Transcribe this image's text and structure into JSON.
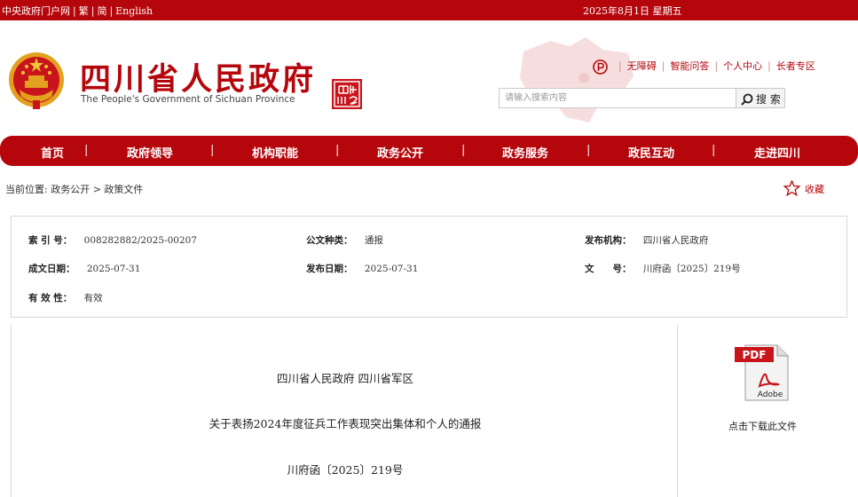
{
  "topbar": {
    "links": [
      "中央政府门户网",
      "繁",
      "简",
      "English"
    ],
    "separator": "|",
    "date": "2025年8月1日 星期五"
  },
  "header": {
    "title": "四川省人民政府",
    "subtitle": "The People's Government of Sichuan Province",
    "seal_text": "四川中国",
    "util_links": [
      "无障碍",
      "智能问答",
      "个人中心",
      "长者专区"
    ],
    "util_separator": "|"
  },
  "search": {
    "placeholder": "请输入搜索内容",
    "button_label": "搜 索"
  },
  "nav": {
    "items": [
      "首页",
      "政府领导",
      "机构职能",
      "政务公开",
      "政务服务",
      "政民互动",
      "走进四川"
    ],
    "separator": "|"
  },
  "breadcrumb": {
    "label": "当前位置: 政务公开 > 政策文件"
  },
  "favorite": {
    "label": "收藏"
  },
  "meta": {
    "index_no_label": "索 引 号：",
    "index_no": "008282882/2025-00207",
    "doc_type_label": "公文种类：",
    "doc_type": "通报",
    "publisher_label": "发布机构：",
    "publisher": "四川省人民政府",
    "written_date_label": "成文日期：",
    "written_date": "2025-07-31",
    "publish_date_label": "发布日期：",
    "publish_date": "2025-07-31",
    "doc_no_label": "文　　号：",
    "doc_no": "川府函〔2025〕219号",
    "validity_label": "有 效 性：",
    "validity": "有效"
  },
  "document": {
    "issuer": "四川省人民政府 四川省军区",
    "title": "关于表扬2024年度征兵工作表现突出集体和个人的通报",
    "number": "川府函〔2025〕219号"
  },
  "sidebar": {
    "pdf_label": "PDF",
    "adobe_label": "Adobe",
    "download_label": "点击下载此文件"
  },
  "colors": {
    "brand_red": "#b5060c",
    "border_gray": "#d8d8d8"
  }
}
